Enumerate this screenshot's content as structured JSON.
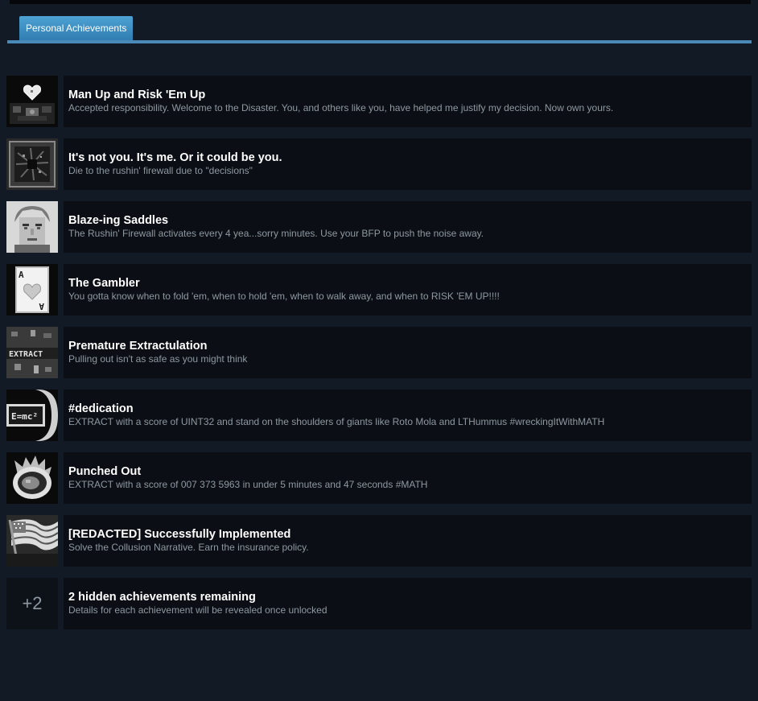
{
  "tabs": [
    {
      "label": "Personal Achievements",
      "active": true
    }
  ],
  "colors": {
    "background": "#121a25",
    "row_background": "#0b0f15",
    "tab_accent": "#4a8ab8",
    "title": "#ffffff",
    "description": "#8f98a0"
  },
  "achievements": [
    {
      "title": "Man Up and Risk 'Em Up",
      "description": "Accepted responsibility. Welcome to the Disaster. You, and others like you, have helped me justify my decision. Now own yours.",
      "icon": "pixel-heart-icon"
    },
    {
      "title": "It's not you. It's me. Or it could be you.",
      "description": "Die to the rushin' firewall due to \"decisions\"",
      "icon": "static-noise-icon"
    },
    {
      "title": "Blaze-ing Saddles",
      "description": "The Rushin' Firewall activates every 4 yea...sorry minutes. Use your BFP to push the noise away.",
      "icon": "face-portrait-icon"
    },
    {
      "title": "The Gambler",
      "description": "You gotta know when to fold 'em, when to hold 'em, when to walk away, and when to RISK 'EM UP!!!!",
      "icon": "playing-card-icon"
    },
    {
      "title": "Premature Extractulation",
      "description": "Pulling out isn't as safe as you might think",
      "icon": "extract-sign-icon"
    },
    {
      "title": "#dedication",
      "description": "EXTRACT with a score of UINT32 and stand on the shoulders of giants like Roto Mola and LTHummus #wreckingItWithMATH",
      "icon": "emc2-icon",
      "icon_text": "E=mc²"
    },
    {
      "title": "Punched Out",
      "description": "EXTRACT with a score of 007 373 5963 in under 5 minutes and 47 seconds #MATH",
      "icon": "flaming-fist-icon"
    },
    {
      "title": "[REDACTED] Successfully Implemented",
      "description": "Solve the Collusion Narrative. Earn the insurance policy.",
      "icon": "flag-icon"
    }
  ],
  "hidden": {
    "count_label": "+2",
    "title": "2 hidden achievements remaining",
    "description": "Details for each achievement will be revealed once unlocked"
  },
  "icon_labels": {
    "card_rank": "A",
    "extract": "EXTRACT"
  }
}
